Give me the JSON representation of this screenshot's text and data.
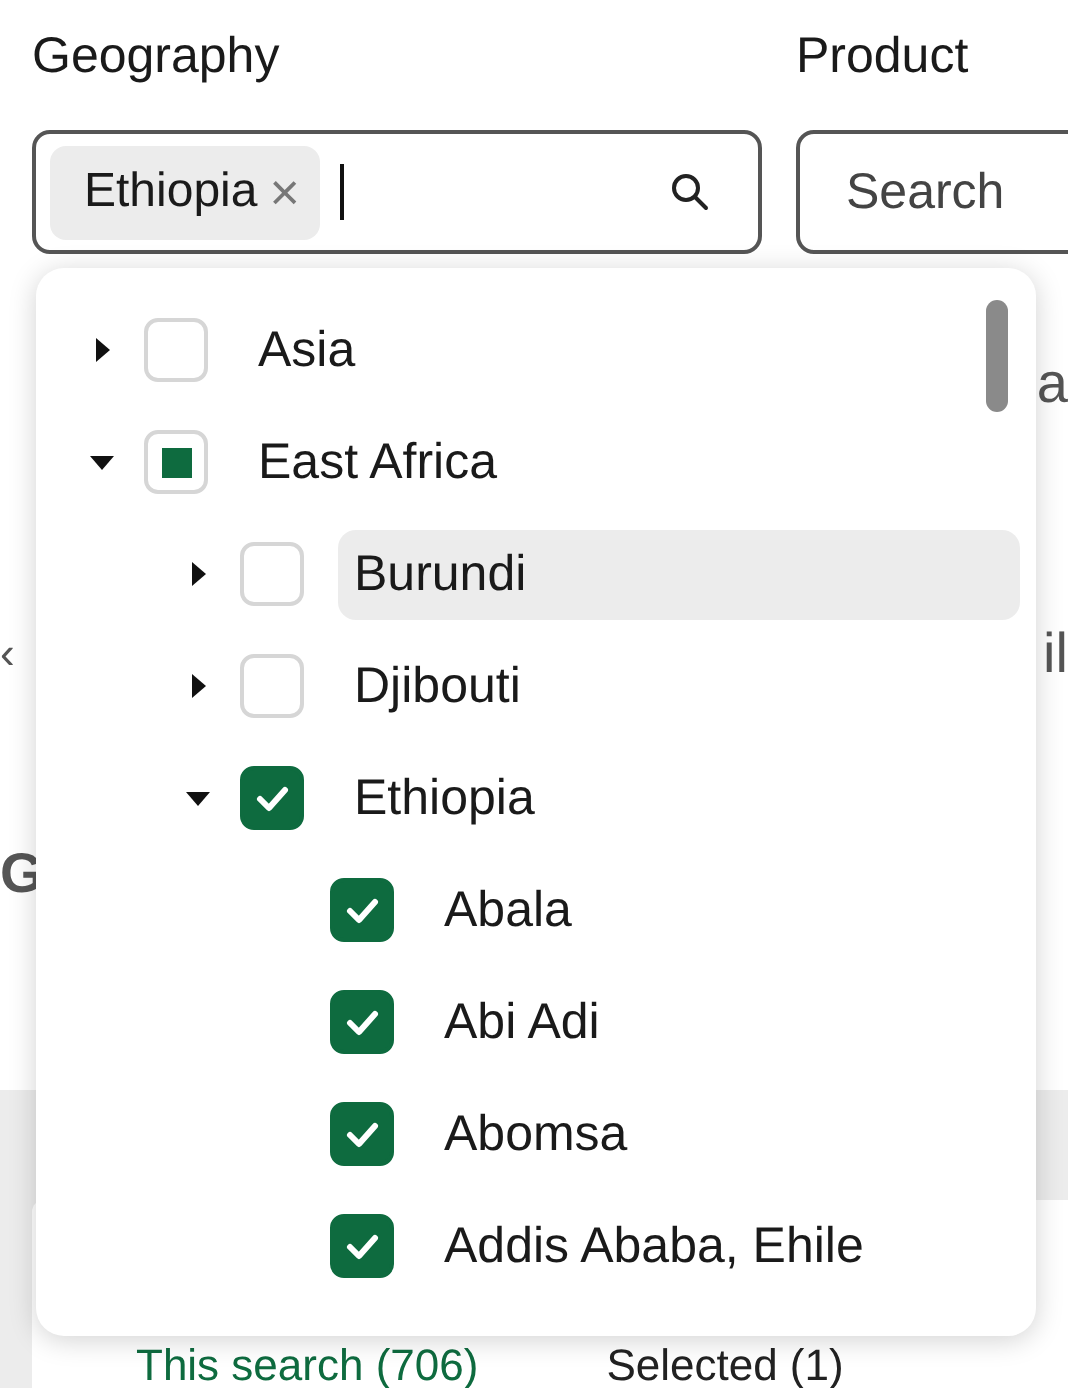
{
  "filters": [
    {
      "label": "Geography",
      "chips": [
        {
          "text": "Ethiopia",
          "remove": "×"
        }
      ],
      "focused": true
    },
    {
      "label": "Product",
      "placeholder": "Search",
      "focused": false
    }
  ],
  "background_fragments": {
    "right_top": "a",
    "left_mid": "‹",
    "right_mid": "il",
    "left_low": "G"
  },
  "result_tabs": [
    {
      "label": "This search (706)",
      "selected": true
    },
    {
      "label": "Selected (1)",
      "selected": false
    }
  ],
  "tree": [
    {
      "label": "Asia",
      "kind": "group",
      "expanded": false,
      "checked": false,
      "indeterminate": false,
      "highlighted": false
    },
    {
      "label": "East Africa",
      "kind": "group",
      "expanded": true,
      "checked": false,
      "indeterminate": true,
      "highlighted": false,
      "children": [
        {
          "label": "Burundi",
          "kind": "group",
          "expanded": false,
          "checked": false,
          "indeterminate": false,
          "highlighted": true
        },
        {
          "label": "Djibouti",
          "kind": "group",
          "expanded": false,
          "checked": false,
          "indeterminate": false,
          "highlighted": false
        },
        {
          "label": "Ethiopia",
          "kind": "group",
          "expanded": true,
          "checked": true,
          "indeterminate": false,
          "highlighted": false,
          "children": [
            {
              "label": "Abala",
              "kind": "leaf",
              "checked": true,
              "indeterminate": false,
              "highlighted": false
            },
            {
              "label": "Abi Adi",
              "kind": "leaf",
              "checked": true,
              "indeterminate": false,
              "highlighted": false
            },
            {
              "label": "Abomsa",
              "kind": "leaf",
              "checked": true,
              "indeterminate": false,
              "highlighted": false
            },
            {
              "label": "Addis Ababa, Ehile",
              "kind": "leaf",
              "checked": true,
              "indeterminate": false,
              "highlighted": false
            }
          ]
        }
      ]
    }
  ]
}
